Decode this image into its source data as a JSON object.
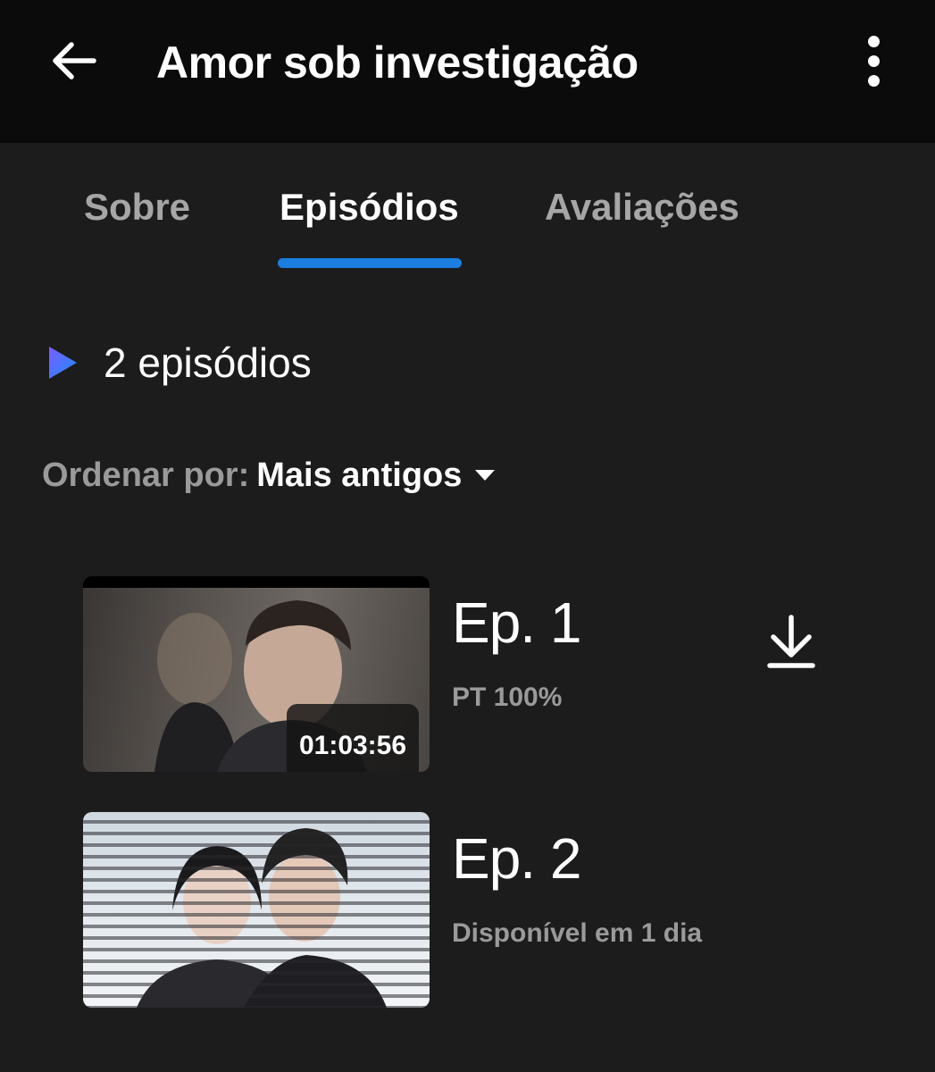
{
  "header": {
    "title": "Amor sob investigação",
    "back_icon": "arrow-left-icon",
    "menu_icon": "more-vertical-icon"
  },
  "tabs": [
    {
      "label": "Sobre",
      "active": false
    },
    {
      "label": "Episódios",
      "active": true
    },
    {
      "label": "Avaliações",
      "active": false
    }
  ],
  "colors": {
    "accent": "#1a7fe0",
    "background": "#1c1c1c",
    "header_background": "#0b0b0b"
  },
  "episodes_section": {
    "count_label": "2 episódios",
    "sort_label": "Ordenar por:",
    "sort_value": "Mais antigos"
  },
  "episodes": [
    {
      "title": "Ep. 1",
      "subtitle": "PT 100%",
      "duration": "01:03:56",
      "downloadable": true
    },
    {
      "title": "Ep. 2",
      "subtitle": "Disponível em 1 dia",
      "duration": "",
      "downloadable": false
    }
  ]
}
